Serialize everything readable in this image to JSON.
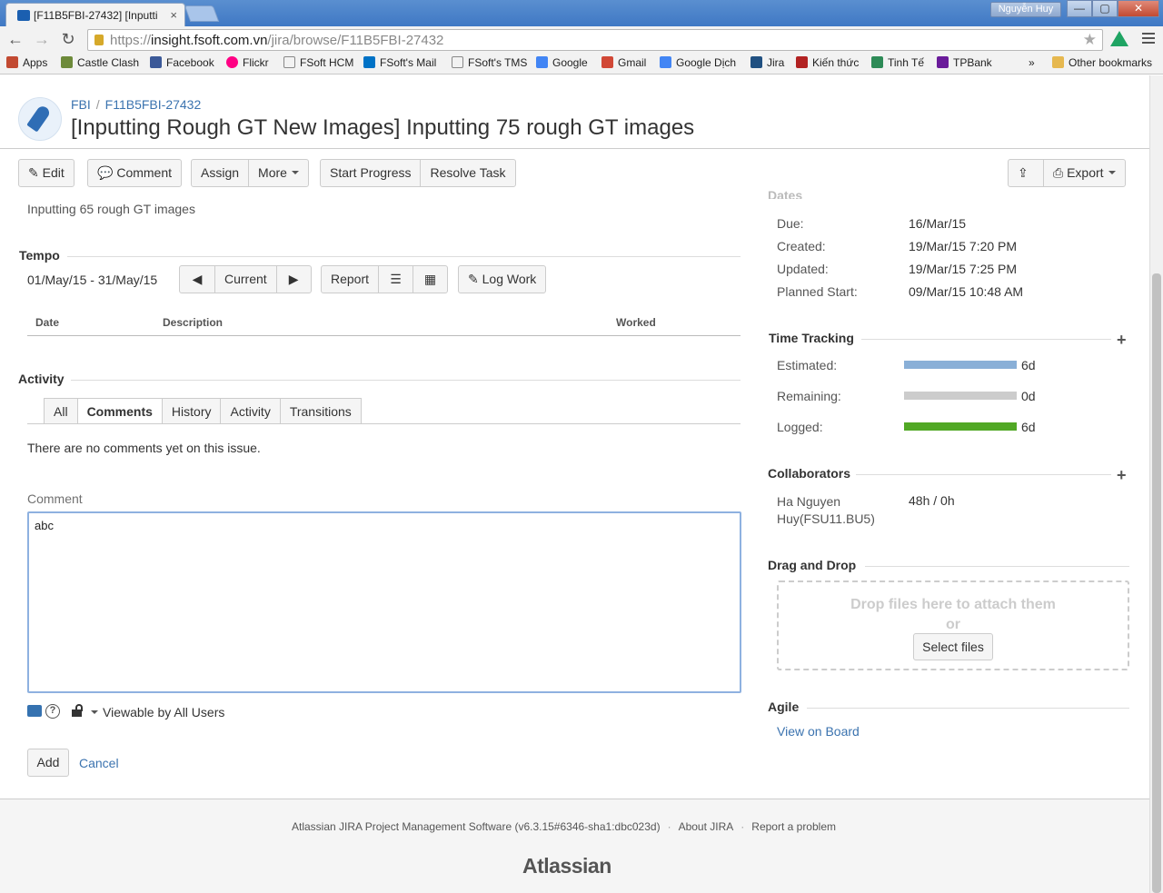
{
  "browser": {
    "tab_title": "[F11B5FBI-27432] [Inputti",
    "user_badge": "Nguyễn Huy",
    "url_scheme": "https://",
    "url_host": "insight.fsoft.com.vn",
    "url_path": "/jira/browse/F11B5FBI-27432",
    "window_min": "—",
    "window_max": "▢",
    "window_close": "✕"
  },
  "bookmarks": {
    "items": [
      {
        "label": "Apps",
        "icon": "apps-grid-icon"
      },
      {
        "label": "Castle Clash",
        "icon": "castle-clash-icon"
      },
      {
        "label": "Facebook",
        "icon": "facebook-icon"
      },
      {
        "label": "Flickr",
        "icon": "flickr-icon"
      },
      {
        "label": "FSoft HCM",
        "icon": "page-icon"
      },
      {
        "label": "FSoft's Mail",
        "icon": "outlook-icon"
      },
      {
        "label": "FSoft's TMS",
        "icon": "page-icon"
      },
      {
        "label": "Google",
        "icon": "google-icon"
      },
      {
        "label": "Gmail",
        "icon": "gmail-icon"
      },
      {
        "label": "Google Dịch",
        "icon": "google-translate-icon"
      },
      {
        "label": "Jira",
        "icon": "jira-icon"
      },
      {
        "label": "Kiến thức",
        "icon": "kienthuc-icon"
      },
      {
        "label": "Tinh Tế",
        "icon": "tinhte-icon"
      },
      {
        "label": "TPBank",
        "icon": "tpbank-icon"
      }
    ],
    "overflow": "»",
    "other": "Other bookmarks"
  },
  "issue": {
    "project": "FBI",
    "key": "F11B5FBI-27432",
    "summary": "[Inputting Rough GT New Images] Inputting 75 rough GT images",
    "description_snippet": "Inputting 65 rough GT images"
  },
  "opsbar": {
    "edit": "Edit",
    "comment": "Comment",
    "assign": "Assign",
    "more": "More",
    "start_progress": "Start Progress",
    "resolve_task": "Resolve Task",
    "export": "Export"
  },
  "tempo": {
    "title": "Tempo",
    "range": "01/May/15 - 31/May/15",
    "current": "Current",
    "report": "Report",
    "log_work": "Log Work",
    "columns": [
      "Date",
      "Description",
      "Worked"
    ]
  },
  "activity": {
    "title": "Activity",
    "tabs": [
      "All",
      "Comments",
      "History",
      "Activity",
      "Transitions"
    ],
    "active_tab": "Comments",
    "empty_message": "There are no comments yet on this issue.",
    "comment_label": "Comment",
    "comment_value": "abc",
    "visibility": "Viewable by All Users",
    "add": "Add",
    "cancel": "Cancel",
    "help_glyph": "?"
  },
  "dates": {
    "section_title": "Dates",
    "rows": [
      {
        "label": "Due:",
        "value": "16/Mar/15"
      },
      {
        "label": "Created:",
        "value": "19/Mar/15 7:20 PM"
      },
      {
        "label": "Updated:",
        "value": "19/Mar/15 7:25 PM"
      },
      {
        "label": "Planned Start:",
        "value": "09/Mar/15 10:48 AM"
      }
    ]
  },
  "time_tracking": {
    "title": "Time Tracking",
    "rows": [
      {
        "label": "Estimated:",
        "value": "6d",
        "color": "#89afd7",
        "fraction": 1.0
      },
      {
        "label": "Remaining:",
        "value": "0d",
        "color": "#cccccc",
        "fraction": 1.0
      },
      {
        "label": "Logged:",
        "value": "6d",
        "color": "#51a825",
        "fraction": 1.0
      }
    ]
  },
  "collaborators": {
    "title": "Collaborators",
    "name_line1": "Ha Nguyen",
    "name_line2": "Huy(FSU11.BU5)",
    "time": "48h / 0h"
  },
  "drag_drop": {
    "title": "Drag and Drop",
    "message": "Drop files here to attach them",
    "or": "or",
    "select": "Select files"
  },
  "agile": {
    "title": "Agile",
    "link": "View on Board"
  },
  "footer": {
    "software": "Atlassian JIRA Project Management Software (v6.3.15#6346-sha1:dbc023d)",
    "about": "About JIRA",
    "report": "Report a problem",
    "logo": "Atlassian",
    "separator": "·"
  },
  "plus_glyph": "+",
  "colors": {
    "link": "#3b73af",
    "estimated": "#89afd7",
    "remaining": "#cccccc",
    "logged": "#51a825"
  }
}
